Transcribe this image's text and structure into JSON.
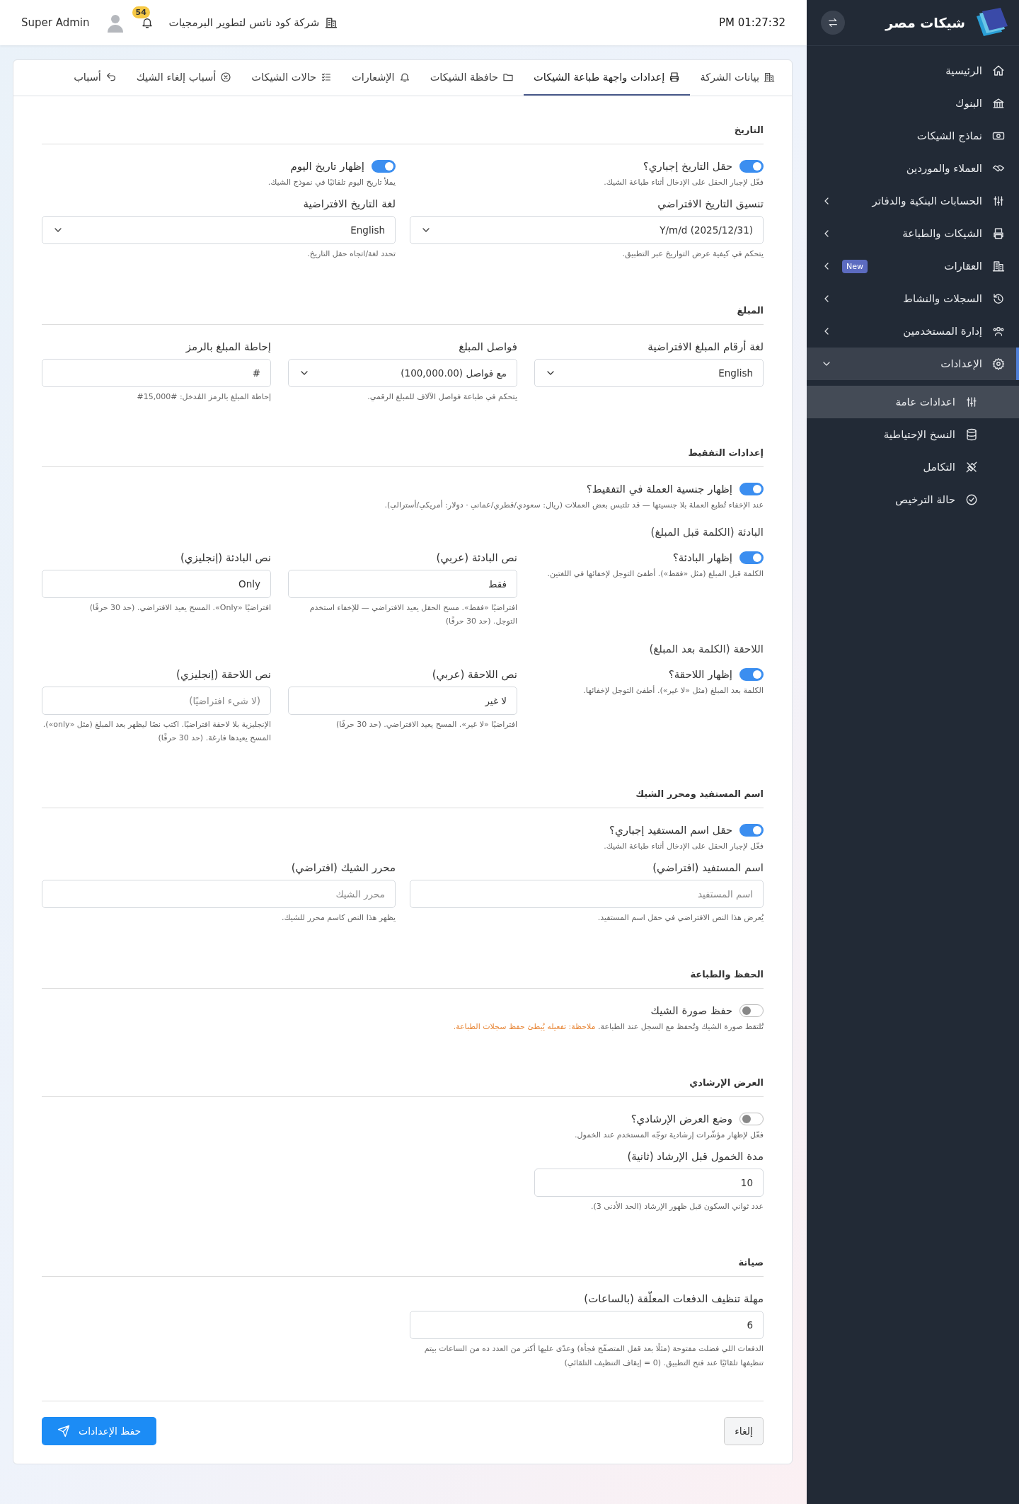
{
  "sidebar": {
    "brand": "شيكات مصر",
    "items": [
      {
        "label": "الرئيسية",
        "has_submenu": false,
        "selected": false
      },
      {
        "label": "البنوك",
        "has_submenu": false,
        "selected": false
      },
      {
        "label": "نماذج الشيكات",
        "has_submenu": false,
        "selected": false
      },
      {
        "label": "العملاء والموردين",
        "has_submenu": false,
        "selected": false
      },
      {
        "label": "الحسابات البنكية والدفاتر",
        "has_submenu": true,
        "expanded": false,
        "selected": false
      },
      {
        "label": "الشيكات والطباعة",
        "has_submenu": true,
        "expanded": false,
        "selected": false
      },
      {
        "label": "العقارات",
        "badge": "New",
        "has_submenu": true,
        "expanded": false,
        "selected": false
      },
      {
        "label": "السجلات والنشاط",
        "has_submenu": true,
        "expanded": false,
        "selected": false
      },
      {
        "label": "إدارة المستخدمين",
        "has_submenu": true,
        "expanded": false,
        "selected": false
      },
      {
        "label": "الإعدادات",
        "has_submenu": true,
        "expanded": true,
        "selected": true,
        "children": [
          {
            "label": "اعدادات عامة",
            "selected": true
          },
          {
            "label": "النسخ الإحتياطية",
            "selected": false
          },
          {
            "label": "التكامل",
            "selected": false
          },
          {
            "label": "حالة الترخيص",
            "selected": false
          }
        ]
      }
    ]
  },
  "topbar": {
    "time": "PM 01:27:32",
    "company": "شركة كود ناتس لتطوير البرمجيات",
    "notifications": "54",
    "user": "Super Admin"
  },
  "tabs": [
    {
      "label": "بيانات الشركة",
      "selected": false
    },
    {
      "label": "إعدادات واجهة طباعة الشيكات",
      "selected": true
    },
    {
      "label": "حافظة الشيكات",
      "selected": false
    },
    {
      "label": "الإشعارات",
      "selected": false
    },
    {
      "label": "حالات الشيكات",
      "selected": false
    },
    {
      "label": "أسباب إلغاء الشيك",
      "selected": false
    },
    {
      "label": "أسباب",
      "selected": false
    }
  ],
  "sections": [
    {
      "title": "التاريخ",
      "rows": [
        {
          "kind": "pair",
          "items": [
            {
              "kind": "toggle",
              "label": "حقل التاريخ إجباري؟",
              "checked": true,
              "hint": "فعّل لإجبار الحقل على الإدخال أثناء طباعة الشيك."
            },
            {
              "kind": "toggle",
              "label": "إظهار تاريخ اليوم",
              "checked": true,
              "hint": "يملأ تاريخ اليوم تلقائيًا في نموذج الشيك."
            }
          ]
        },
        {
          "kind": "pair",
          "items": [
            {
              "kind": "select",
              "label": "تنسيق التاريخ الافتراضي",
              "value": "Y/m/d (2025/12/31)",
              "hint": "يتحكم في كيفية عرض التواريخ عبر التطبيق."
            },
            {
              "kind": "select",
              "label": "لغة التاريخ الافتراضية",
              "value": "English",
              "hint": "تحدد لغة/اتجاه حقل التاريخ."
            }
          ]
        }
      ]
    },
    {
      "title": "المبلغ",
      "rows": [
        {
          "kind": "triple",
          "items": [
            {
              "kind": "select",
              "label": "لغة أرقام المبلغ الافتراضية",
              "value": "English"
            },
            {
              "kind": "select",
              "label": "فواصل المبلغ",
              "value": "مع فواصل (100,000.00)",
              "hint": "يتحكم في طباعة فواصل الآلاف للمبلغ الرقمي."
            },
            {
              "kind": "input",
              "label": "إحاطة المبلغ بالرمز",
              "value": "#",
              "hint": "إحاطة المبلغ بالرمز المُدخل: #15,000#"
            }
          ]
        }
      ]
    },
    {
      "title": "إعدادات التفقيط",
      "rows": [
        {
          "kind": "full",
          "items": [
            {
              "kind": "toggle",
              "label": "إظهار جنسية العملة في التفقيط؟",
              "checked": true,
              "hint": "عند الإخفاء تُطبع العملة بلا جنسيتها — قد تلتبس بعض العملات (ريال: سعودي/قطري/عماني · دولار: أمريكي/أسترالي)."
            }
          ]
        },
        {
          "kind": "subheading",
          "text": "البادئة (الكلمة قبل المبلغ)"
        },
        {
          "kind": "triple",
          "items": [
            {
              "kind": "toggle",
              "label": "إظهار البادئة؟",
              "checked": true,
              "hint": "الكلمة قبل المبلغ (مثل «فقط»). أطفئ التوجل لإخفائها في اللغتين."
            },
            {
              "kind": "input",
              "label": "نص البادئة (عربي)",
              "value": "فقط",
              "hint": "افتراضيًا «فقط». مسح الحقل يعيد الافتراضي — للإخفاء استخدم التوجل. (حد 30 حرفًا)"
            },
            {
              "kind": "input",
              "label": "نص البادئة (إنجليزي)",
              "value": "Only",
              "hint": "افتراضيًا «Only». المسح يعيد الافتراضي. (حد 30 حرفًا)"
            }
          ]
        },
        {
          "kind": "subheading",
          "text": "اللاحقة (الكلمة بعد المبلغ)"
        },
        {
          "kind": "triple",
          "items": [
            {
              "kind": "toggle",
              "label": "إظهار اللاحقة؟",
              "checked": true,
              "hint": "الكلمة بعد المبلغ (مثل «لا غير»). أطفئ التوجل لإخفائها."
            },
            {
              "kind": "input",
              "label": "نص اللاحقة (عربي)",
              "value": "لا غير",
              "hint": "افتراضيًا «لا غير». المسح يعيد الافتراضي. (حد 30 حرفًا)"
            },
            {
              "kind": "input",
              "label": "نص اللاحقة (إنجليزي)",
              "placeholder": "(لا شيء افتراضيًا)",
              "hint": "الإنجليزية بلا لاحقة افتراضيًا. اكتب نصًا ليظهر بعد المبلغ (مثل «only»). المسح يعيدها فارغة. (حد 30 حرفًا)"
            }
          ]
        }
      ]
    },
    {
      "title": "اسم المستفيد ومحرر الشيك",
      "rows": [
        {
          "kind": "pair",
          "items": [
            {
              "kind": "toggle",
              "label": "حقل اسم المستفيد إجباري؟",
              "checked": true,
              "hint": "فعّل لإجبار الحقل على الإدخال أثناء طباعة الشيك."
            }
          ]
        },
        {
          "kind": "pair",
          "items": [
            {
              "kind": "input",
              "label": "اسم المستفيد (افتراضي)",
              "placeholder": "اسم المستفيد",
              "hint": "يُعرض هذا النص الافتراضي في حقل اسم المستفيد."
            },
            {
              "kind": "input",
              "label": "محرر الشيك (افتراضي)",
              "placeholder": "محرر الشيك",
              "hint": "يظهر هذا النص كاسم محرر للشيك."
            }
          ]
        }
      ]
    },
    {
      "title": "الحفظ والطباعة",
      "rows": [
        {
          "kind": "full",
          "items": [
            {
              "kind": "toggle",
              "label": "حفظ صورة الشيك",
              "checked": false,
              "hint": "تُلتقط صورة الشيك وتُحفظ مع السجل عند الطباعة.",
              "warning": "ملاحظة: تفعيله يُبطئ حفظ سجلات الطباعة."
            }
          ]
        }
      ]
    },
    {
      "title": "العرض الإرشادي",
      "rows": [
        {
          "kind": "full",
          "items": [
            {
              "kind": "toggle",
              "label": "وضع العرض الإرشادي؟",
              "checked": false,
              "hint": "فعّل لإظهار مؤشّرات إرشادية توجّه المستخدم عند الخمول."
            }
          ]
        },
        {
          "kind": "triple",
          "items": [
            {
              "kind": "input",
              "label": "مدة الخمول قبل الإرشاد (ثانية)",
              "value": "10",
              "hint": "عدد ثواني السكون قبل ظهور الإرشاد (الحد الأدنى 3)."
            }
          ]
        }
      ]
    },
    {
      "title": "صيانة",
      "rows": [
        {
          "kind": "pair",
          "items": [
            {
              "kind": "input",
              "label": "مهلة تنظيف الدفعات المعلّقة (بالساعات)",
              "value": "6",
              "hint": "الدفعات اللي فضلت مفتوحة (مثلًا بعد قفل المتصفّح فجأة) وعدّى عليها أكتر من العدد ده من الساعات بيتم تنظيفها تلقائيًا عند فتح التطبيق. (0 = إيقاف التنظيف التلقائي)"
            }
          ]
        }
      ]
    }
  ],
  "footer": {
    "cancel": "إلغاء",
    "save": "حفظ الإعدادات"
  }
}
